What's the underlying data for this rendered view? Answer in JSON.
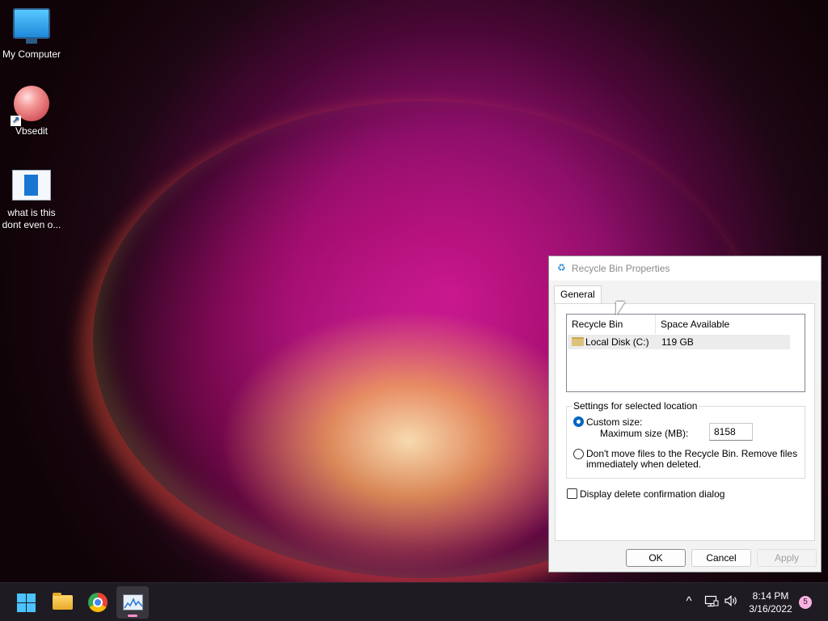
{
  "desktop": {
    "icons": [
      {
        "label": "My Computer",
        "icon": "monitor-icon"
      },
      {
        "label": "Vbsedit",
        "icon": "vbsedit-ball-icon"
      },
      {
        "label": "what is this dont even o...",
        "icon": "document-icon"
      }
    ]
  },
  "dialog": {
    "title": "Recycle Bin Properties",
    "title_icon": "recycle-bin-icon",
    "tabs": [
      {
        "label": "General",
        "selected": true
      }
    ],
    "location_list": {
      "columns": [
        "Recycle Bin Location",
        "Space Available"
      ],
      "rows": [
        {
          "location": "Local Disk (C:)",
          "space": "119 GB",
          "icon": "folder-icon"
        }
      ]
    },
    "settings": {
      "group_label": "Settings for selected location",
      "custom_size_label": "Custom size:",
      "custom_size_selected": true,
      "max_size_label": "Maximum size (MB):",
      "max_size_value": "8158",
      "dont_move_label_line1": "Don't move files to the Recycle Bin. Remove files",
      "dont_move_label_line2": "immediately when deleted.",
      "dont_move_selected": false
    },
    "confirm_label": "Display delete confirmation dialog",
    "confirm_checked": false,
    "buttons": {
      "ok": "OK",
      "cancel": "Cancel",
      "apply": "Apply"
    },
    "apply_enabled": false
  },
  "taskbar": {
    "apps": [
      {
        "name": "start-button",
        "icon": "windows-logo-icon"
      },
      {
        "name": "file-explorer",
        "icon": "folder-icon"
      },
      {
        "name": "chrome",
        "icon": "chrome-icon"
      },
      {
        "name": "performance-monitor",
        "icon": "performance-monitor-icon",
        "active": true
      }
    ],
    "tray": {
      "chevron": "^",
      "network_icon": "network-icon",
      "volume_icon": "volume-icon",
      "time": "8:14 PM",
      "date": "3/16/2022",
      "notification_count": "5"
    }
  },
  "colors": {
    "accent": "#0067c0",
    "taskbar_bg": "#1f1b22",
    "start_logo": "#4cc2ff"
  }
}
